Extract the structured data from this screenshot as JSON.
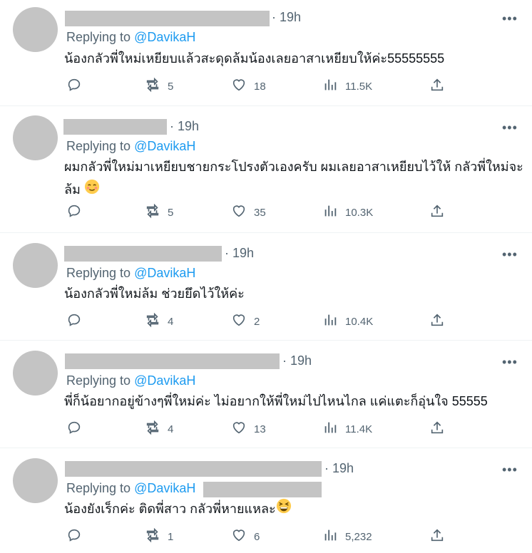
{
  "reply_prefix": "Replying to",
  "mention": "@DavikaH",
  "tweets": [
    {
      "time": "· 19h",
      "text": "น้องกลัวพี่ใหม่เหยียบแล้วสะดุดล้มน้องเลยอาสาเหยียบให้ค่ะ55555555",
      "replies": "",
      "retweets": "5",
      "likes": "18",
      "views": "11.5K"
    },
    {
      "time": "· 19h",
      "text": "ผมกลัวพี่ใหม่มาเหยียบชายกระโปรงตัวเองครับ ผมเลยอาสาเหยียบไว้ให้ กลัวพี่ใหม่จะล้ม",
      "emoji": "blush-emoji",
      "replies": "",
      "retweets": "5",
      "likes": "35",
      "views": "10.3K"
    },
    {
      "time": "· 19h",
      "text": "น้องกลัวพี่ใหม่ล้ม ช่วยยึดไว้ให้ค่ะ",
      "replies": "",
      "retweets": "4",
      "likes": "2",
      "views": "10.4K"
    },
    {
      "time": "· 19h",
      "text": "พี่ก็น้อยากอยู่ข้างๆพี่ใหม่ค่ะ ไม่อยากให้พี่ใหม่ไปไหนไกล แค่แตะก็อุ่นใจ 55555",
      "replies": "",
      "retweets": "4",
      "likes": "13",
      "views": "11.4K"
    },
    {
      "time": "· 19h",
      "text": "น้องยังเร็กค่ะ ติดพี่สาว กลัวพี่หายแหละ",
      "emoji": "grinning-squint-emoji",
      "replies": "",
      "retweets": "1",
      "likes": "6",
      "views": "5,232"
    }
  ],
  "more_label": "•••",
  "colors": {
    "accent": "#1d9bf0",
    "muted": "#536471",
    "redaction": "#c4c4c4"
  }
}
